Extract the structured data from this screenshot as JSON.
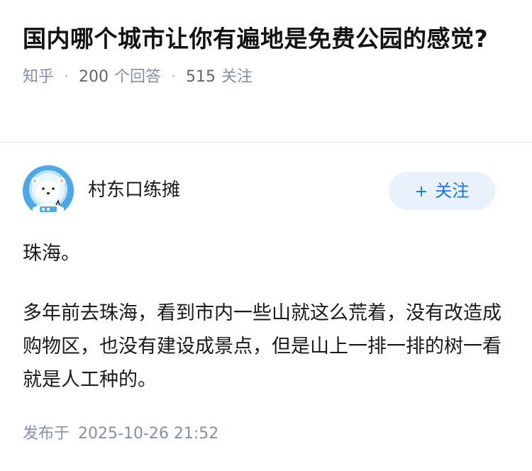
{
  "question": {
    "title": "国内哪个城市让你有遍地是免费公园的感觉?",
    "site": "知乎",
    "answer_count": "200",
    "answer_unit": "个回答",
    "follower_count": "515",
    "follower_unit": "关注",
    "separator": "·"
  },
  "author": {
    "name": "村东口练摊",
    "avatar_icon": "polar-bear-astronaut-avatar",
    "follow_plus": "+",
    "follow_label": "关注"
  },
  "answer": {
    "paragraphs": [
      "珠海。",
      "多年前去珠海，看到市内一些山就这么荒着，没有改造成购物区，也没有建设成景点，但是山上一排一排的树一看就是人工种的。"
    ],
    "publish_label": "发布于",
    "publish_time": "2025-10-26 21:52"
  },
  "colors": {
    "accent": "#1772f6",
    "follow_bg": "#e9f1fc",
    "meta_text": "#8590a6",
    "avatar_blue": "#4fa8e6"
  }
}
